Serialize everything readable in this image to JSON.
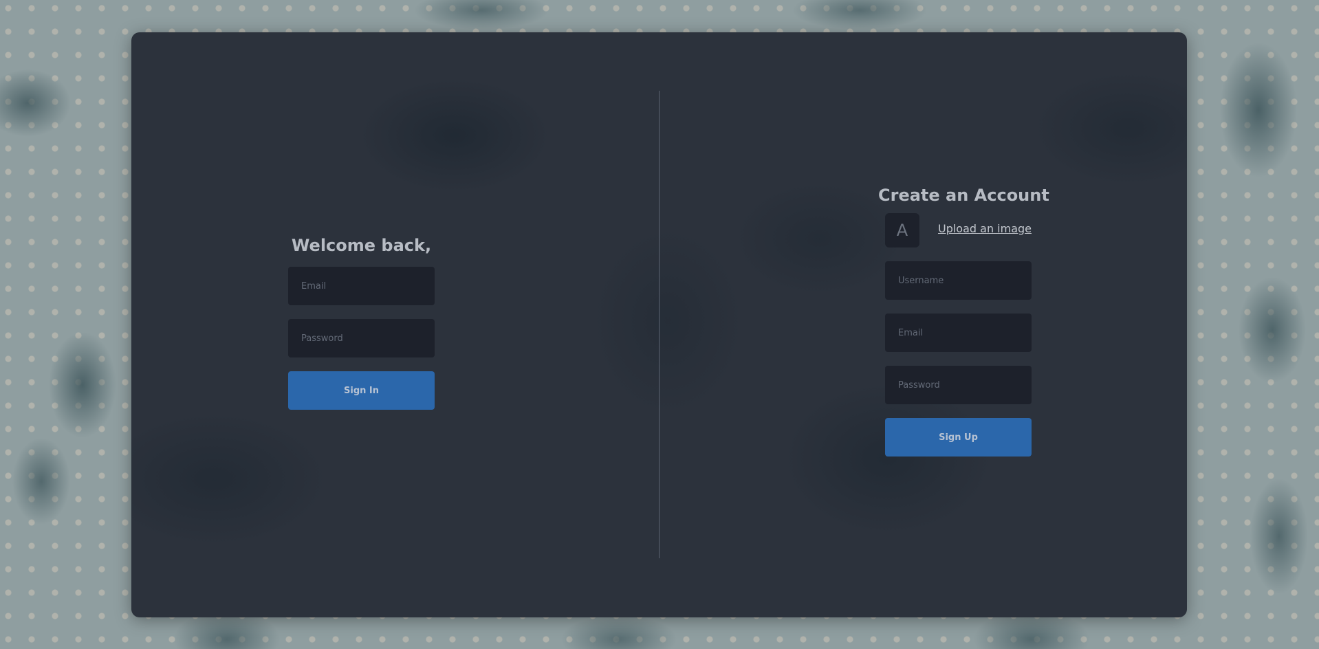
{
  "signin": {
    "title": "Welcome back,",
    "email_placeholder": "Email",
    "password_placeholder": "Password",
    "submit_label": "Sign In"
  },
  "signup": {
    "title": "Create an Account",
    "avatar_letter": "A",
    "upload_label": "Upload an image",
    "username_placeholder": "Username",
    "email_placeholder": "Email",
    "password_placeholder": "Password",
    "submit_label": "Sign Up"
  },
  "colors": {
    "card": "#2c323c",
    "input": "#1d212b",
    "button": "#2b67ab",
    "text": "#b7bcc4",
    "background": "#8f9ea0"
  },
  "icons": {
    "background": "floral-pattern"
  }
}
